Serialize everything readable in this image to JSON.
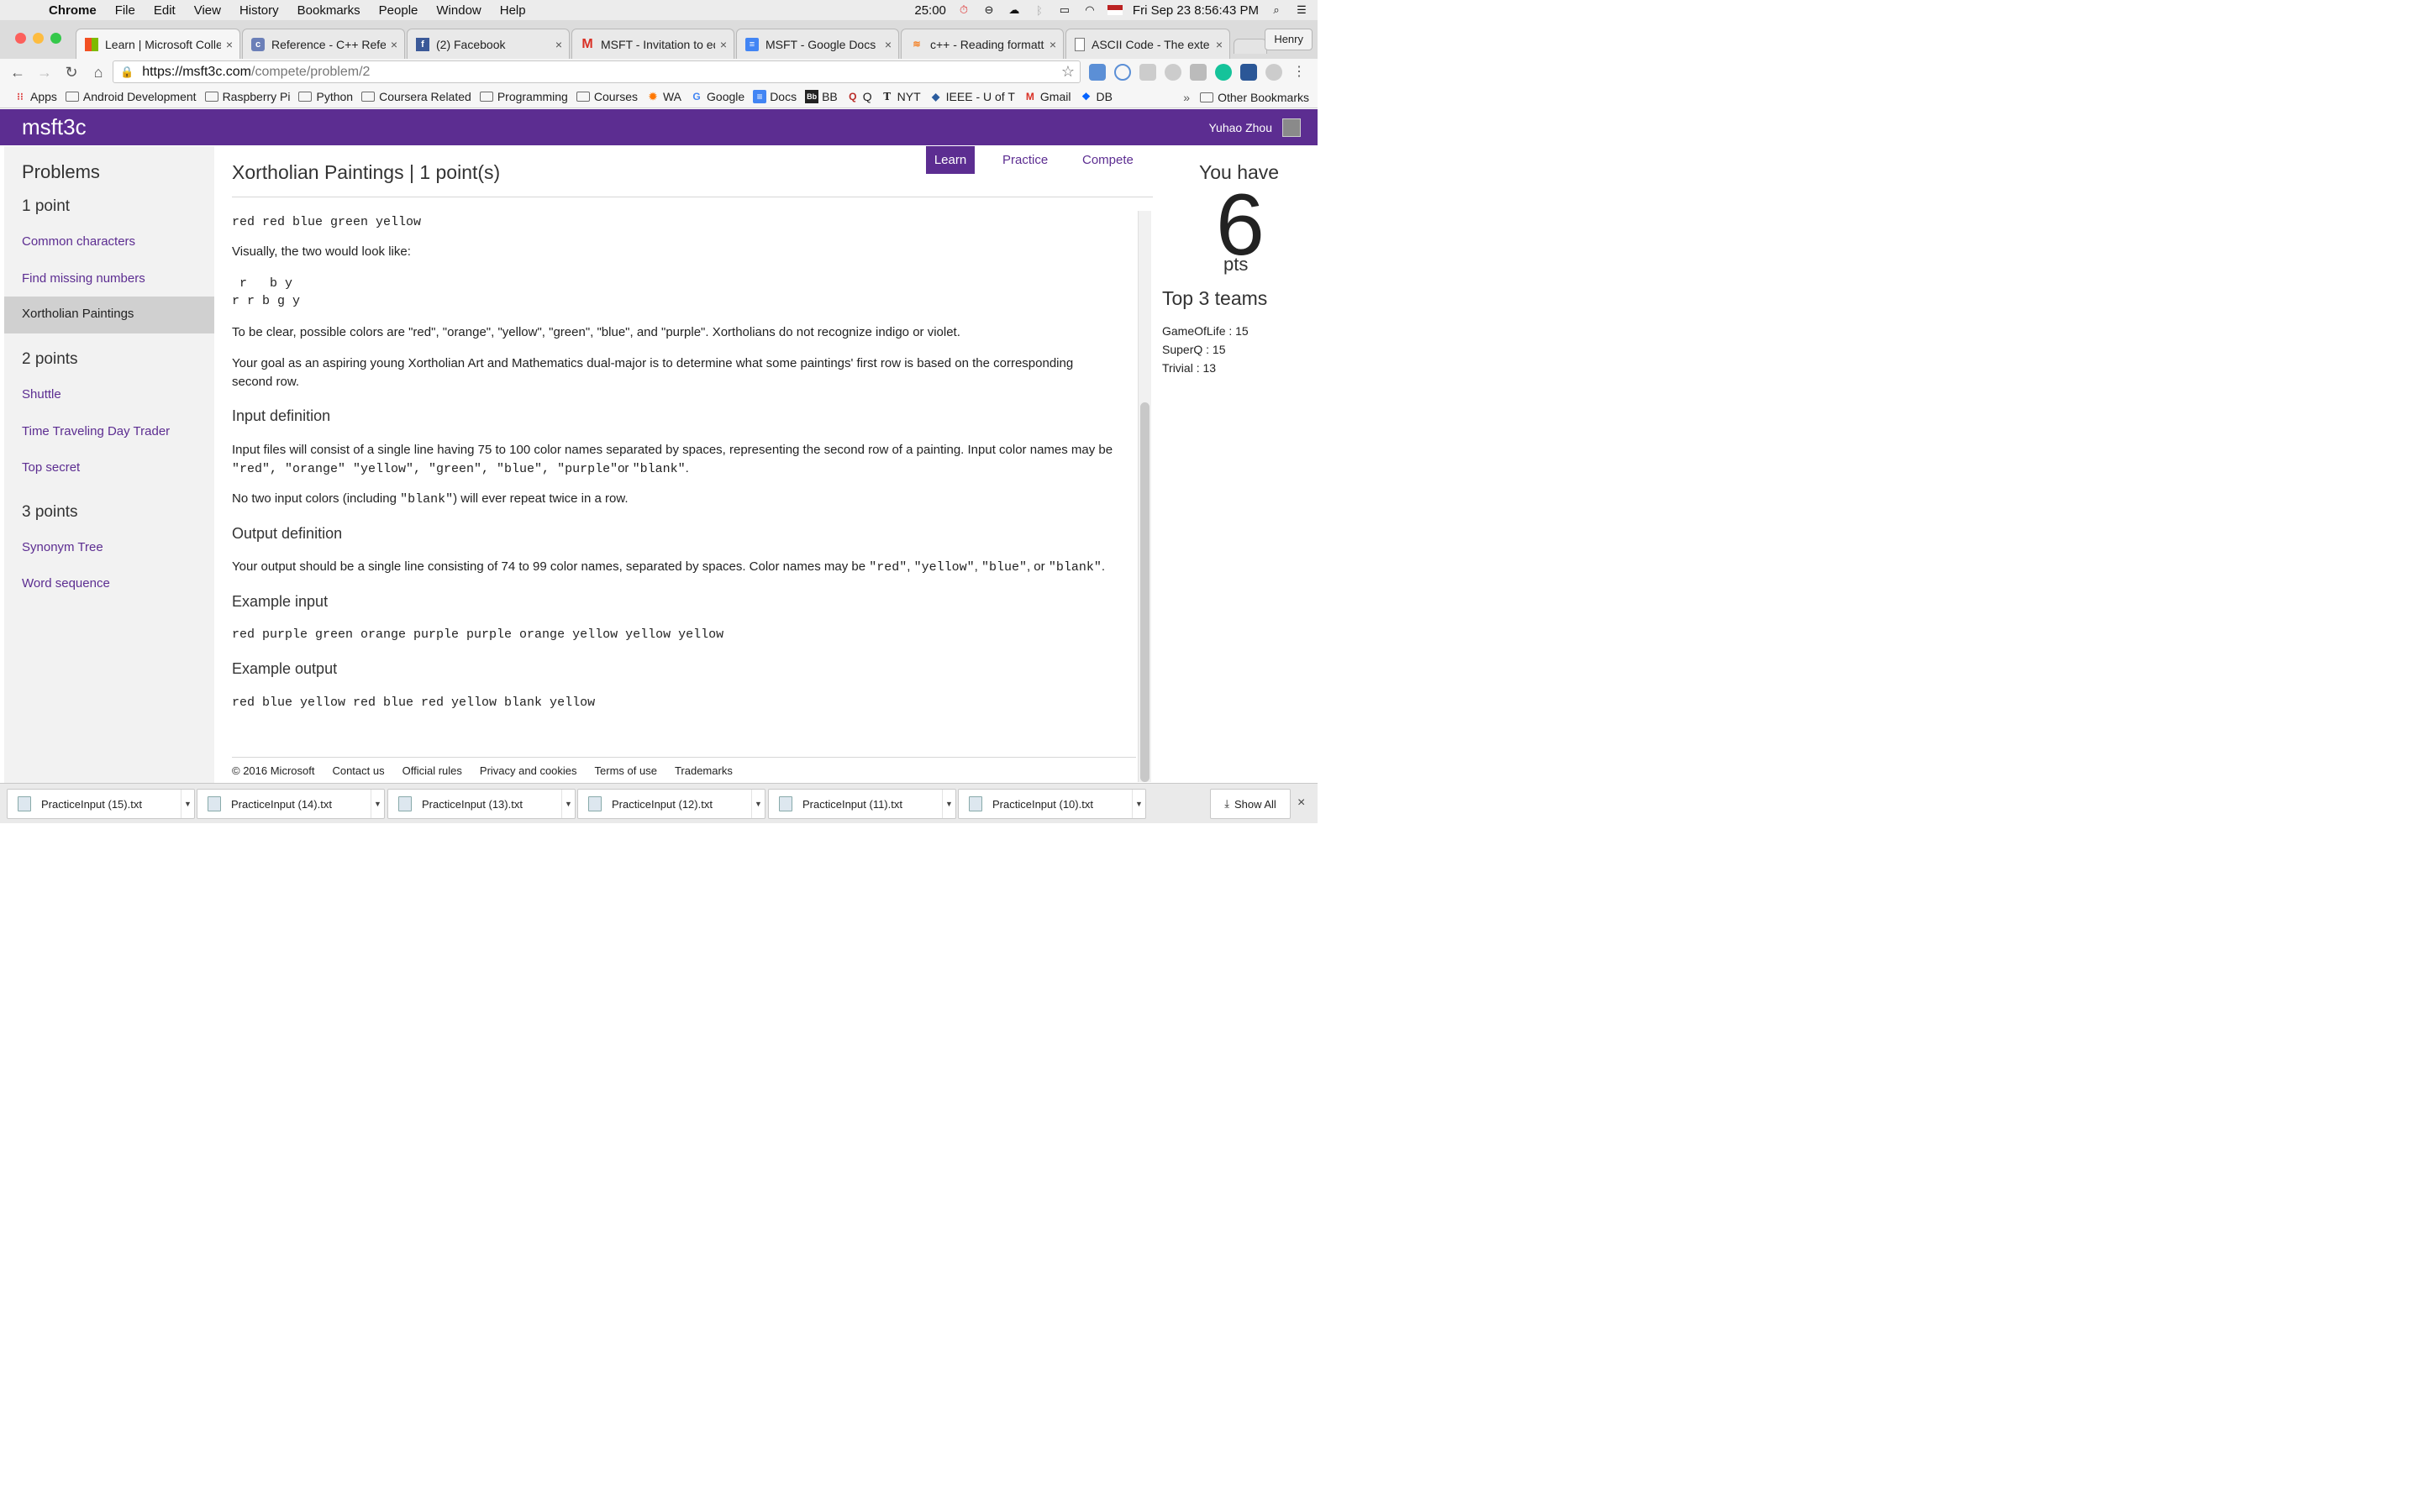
{
  "menubar": {
    "app": "Chrome",
    "items": [
      "File",
      "Edit",
      "View",
      "History",
      "Bookmarks",
      "People",
      "Window",
      "Help"
    ],
    "timer": "25:00",
    "datetime": "Fri Sep 23  8:56:43 PM"
  },
  "tabs": [
    {
      "title": "Learn | Microsoft Colle",
      "icon": "microsoft-icon"
    },
    {
      "title": "Reference - C++ Refer",
      "icon": "cplusplus-icon"
    },
    {
      "title": "(2) Facebook",
      "icon": "facebook-icon"
    },
    {
      "title": "MSFT - Invitation to ed",
      "icon": "gmail-icon"
    },
    {
      "title": "MSFT - Google Docs",
      "icon": "docs-icon"
    },
    {
      "title": "c++ - Reading formatt",
      "icon": "stackoverflow-icon"
    },
    {
      "title": "ASCII Code - The exte",
      "icon": "page-icon"
    }
  ],
  "profile": "Henry",
  "url": {
    "host": "https://msft3c.com",
    "path": "/compete/problem/2"
  },
  "bookmarks": [
    {
      "label": "Apps",
      "icon": "apps-icon"
    },
    {
      "label": "Android Development",
      "icon": "folder-icon"
    },
    {
      "label": "Raspberry Pi",
      "icon": "folder-icon"
    },
    {
      "label": "Python",
      "icon": "folder-icon"
    },
    {
      "label": "Coursera Related",
      "icon": "folder-icon"
    },
    {
      "label": "Programming",
      "icon": "folder-icon"
    },
    {
      "label": "Courses",
      "icon": "folder-icon"
    },
    {
      "label": "WA",
      "icon": "wolfram-icon"
    },
    {
      "label": "Google",
      "icon": "google-icon"
    },
    {
      "label": "Docs",
      "icon": "docs-icon"
    },
    {
      "label": "BB",
      "icon": "blackboard-icon"
    },
    {
      "label": "Q",
      "icon": "quora-icon"
    },
    {
      "label": "NYT",
      "icon": "nyt-icon"
    },
    {
      "label": "IEEE - U of T",
      "icon": "ieee-icon"
    },
    {
      "label": "Gmail",
      "icon": "gmail-icon"
    },
    {
      "label": "DB",
      "icon": "dropbox-icon"
    }
  ],
  "other_bookmarks": "Other Bookmarks",
  "site": {
    "brand": "msft3c",
    "user": "Yuhao Zhou"
  },
  "nav": {
    "header": "Problems",
    "groups": [
      {
        "label": "1 point",
        "items": [
          "Common characters",
          "Find missing numbers",
          "Xortholian Paintings"
        ]
      },
      {
        "label": "2 points",
        "items": [
          "Shuttle",
          "Time Traveling Day Trader",
          "Top secret"
        ]
      },
      {
        "label": "3 points",
        "items": [
          "Synonym Tree",
          "Word sequence"
        ]
      }
    ],
    "selected": "Xortholian Paintings"
  },
  "modes": {
    "learn": "Learn",
    "practice": "Practice",
    "compete": "Compete"
  },
  "problem": {
    "title": "Xortholian Paintings | 1 point(s)",
    "code_top": "red red blue green yellow",
    "visual_intro": "Visually, the two would look like:",
    "visual_line1": " r   b y",
    "visual_line2": "r r b g y",
    "colors_text": "To be clear, possible colors are \"red\", \"orange\", \"yellow\", \"green\", \"blue\", and \"purple\". Xortholians do not recognize indigo or violet.",
    "goal_text": "Your goal as an aspiring young Xortholian Art and Mathematics dual-major is to determine what some paintings' first row is based on the corresponding second row.",
    "input_heading": "Input definition",
    "input_text_a": "Input files will consist of a single line having 75 to 100 color names separated by spaces, representing the second row of a painting. Input color names may be ",
    "input_codes": "\"red\", \"orange\" \"yellow\", \"green\", \"blue\", \"purple\"",
    "input_or": "or ",
    "input_blank": "\"blank\"",
    "input_end": ".",
    "no_repeat_a": "No two input colors (including ",
    "no_repeat_code": "\"blank\"",
    "no_repeat_b": ") will ever repeat twice in a row.",
    "output_heading": "Output definition",
    "output_text_a": "Your output should be a single line consisting of 74 to 99 color names, separated by spaces. Color names may be ",
    "output_code1": "\"red\"",
    "output_sep1": ", ",
    "output_code2": "\"yellow\"",
    "output_sep2": ", ",
    "output_code3": "\"blue\"",
    "output_sep3": ", or ",
    "output_code4": "\"blank\"",
    "output_end": ".",
    "example_input_heading": "Example input",
    "example_input": "red purple green orange purple purple orange yellow yellow yellow",
    "example_output_heading": "Example output",
    "example_output": "red blue yellow red blue red yellow blank yellow"
  },
  "footer": [
    "© 2016 Microsoft",
    "Contact us",
    "Official rules",
    "Privacy and cookies",
    "Terms of use",
    "Trademarks"
  ],
  "score": {
    "you_have": "You have",
    "points": "6",
    "unit": "pts",
    "top_heading": "Top 3 teams",
    "teams": [
      "GameOfLife : 15",
      "SuperQ : 15",
      "Trivial : 13"
    ]
  },
  "downloads": [
    "PracticeInput (15).txt",
    "PracticeInput (14).txt",
    "PracticeInput (13).txt",
    "PracticeInput (12).txt",
    "PracticeInput (11).txt",
    "PracticeInput (10).txt"
  ],
  "show_all": "Show All",
  "colors": {
    "brand": "#5c2d91"
  }
}
